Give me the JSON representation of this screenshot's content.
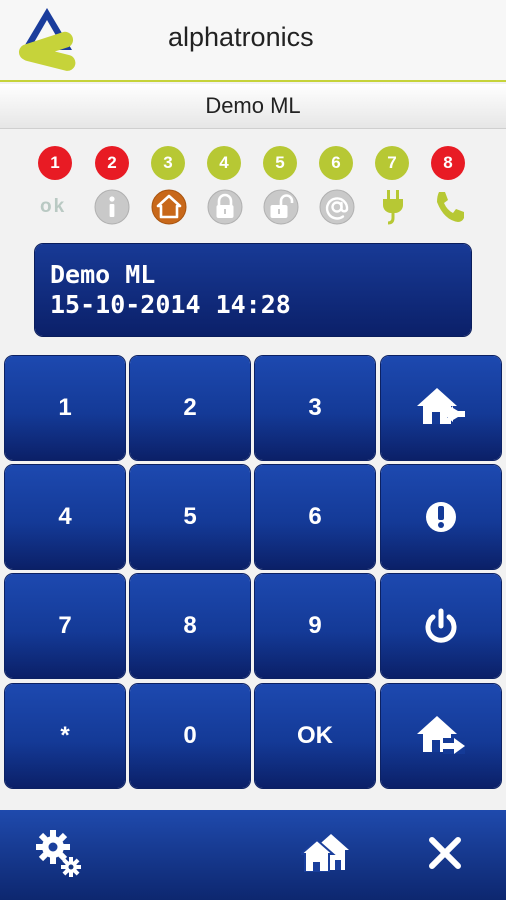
{
  "app": {
    "title": "alphatronics",
    "subtitle": "Demo ML"
  },
  "zones": [
    {
      "label": "1",
      "state": "alarm"
    },
    {
      "label": "2",
      "state": "alarm"
    },
    {
      "label": "3",
      "state": "ok"
    },
    {
      "label": "4",
      "state": "ok"
    },
    {
      "label": "5",
      "state": "ok"
    },
    {
      "label": "6",
      "state": "ok"
    },
    {
      "label": "7",
      "state": "ok"
    },
    {
      "label": "8",
      "state": "alarm"
    }
  ],
  "status": {
    "ok_label": "ok",
    "icons": [
      "info-icon",
      "home-icon",
      "lock-icon",
      "unlock-icon",
      "at-icon",
      "power-plug-icon",
      "phone-icon"
    ]
  },
  "display": {
    "line1": "Demo ML",
    "line2": "15-10-2014 14:28"
  },
  "keypad": {
    "k1": "1",
    "k2": "2",
    "k3": "3",
    "k4": "4",
    "k5": "5",
    "k6": "6",
    "k7": "7",
    "k8": "8",
    "k9": "9",
    "kstar": "*",
    "k0": "0",
    "kok": "OK"
  },
  "keypad_icons": [
    "home-enter-icon",
    "alert-icon",
    "power-icon",
    "home-exit-icon"
  ],
  "bottom_bar": [
    "settings-icon",
    "home-icon",
    "close-icon"
  ],
  "colors": {
    "accent": "#c6d33a",
    "alarm": "#e81b24",
    "ok": "#b7c834",
    "home": "#c8681a",
    "panel": "#143a97"
  }
}
